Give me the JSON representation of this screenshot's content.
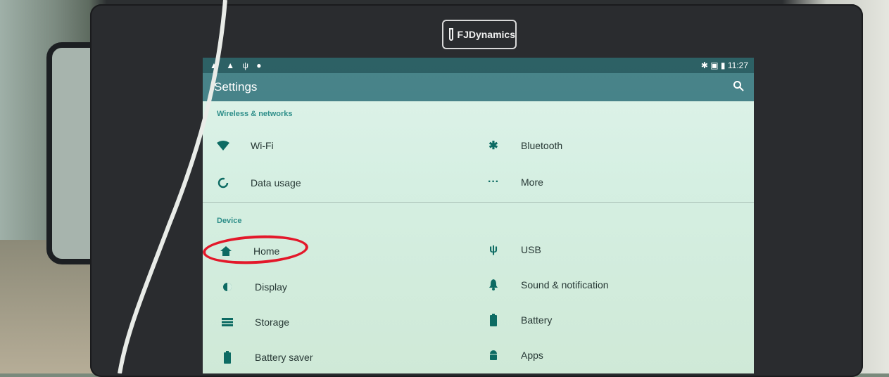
{
  "brand": {
    "logo_text": "FJDynamics"
  },
  "status_bar": {
    "left_icons": "▲ ▲ ψ ●",
    "time": "11:27",
    "right_icons": "✱ ▣ ▮"
  },
  "app_bar": {
    "title": "Settings",
    "search_icon": "search-icon"
  },
  "sections": {
    "wireless": {
      "header": "Wireless & networks",
      "items": [
        {
          "label": "Wi-Fi",
          "icon": "wifi-icon"
        },
        {
          "label": "Bluetooth",
          "icon": "bluetooth-icon"
        },
        {
          "label": "Data usage",
          "icon": "data-usage-icon"
        },
        {
          "label": "More",
          "icon": "more-icon"
        }
      ]
    },
    "device": {
      "header": "Device",
      "items": [
        {
          "label": "Home",
          "icon": "home-icon"
        },
        {
          "label": "USB",
          "icon": "usb-icon"
        },
        {
          "label": "Display",
          "icon": "display-icon"
        },
        {
          "label": "Sound & notification",
          "icon": "bell-icon"
        },
        {
          "label": "Storage",
          "icon": "storage-icon"
        },
        {
          "label": "Battery",
          "icon": "battery-icon"
        },
        {
          "label": "Battery saver",
          "icon": "battery-saver-icon"
        },
        {
          "label": "Apps",
          "icon": "android-icon"
        }
      ]
    }
  },
  "colors": {
    "accent": "#2f8f8a",
    "annotation": "#e3182a",
    "app_bar": "#1e646e"
  }
}
